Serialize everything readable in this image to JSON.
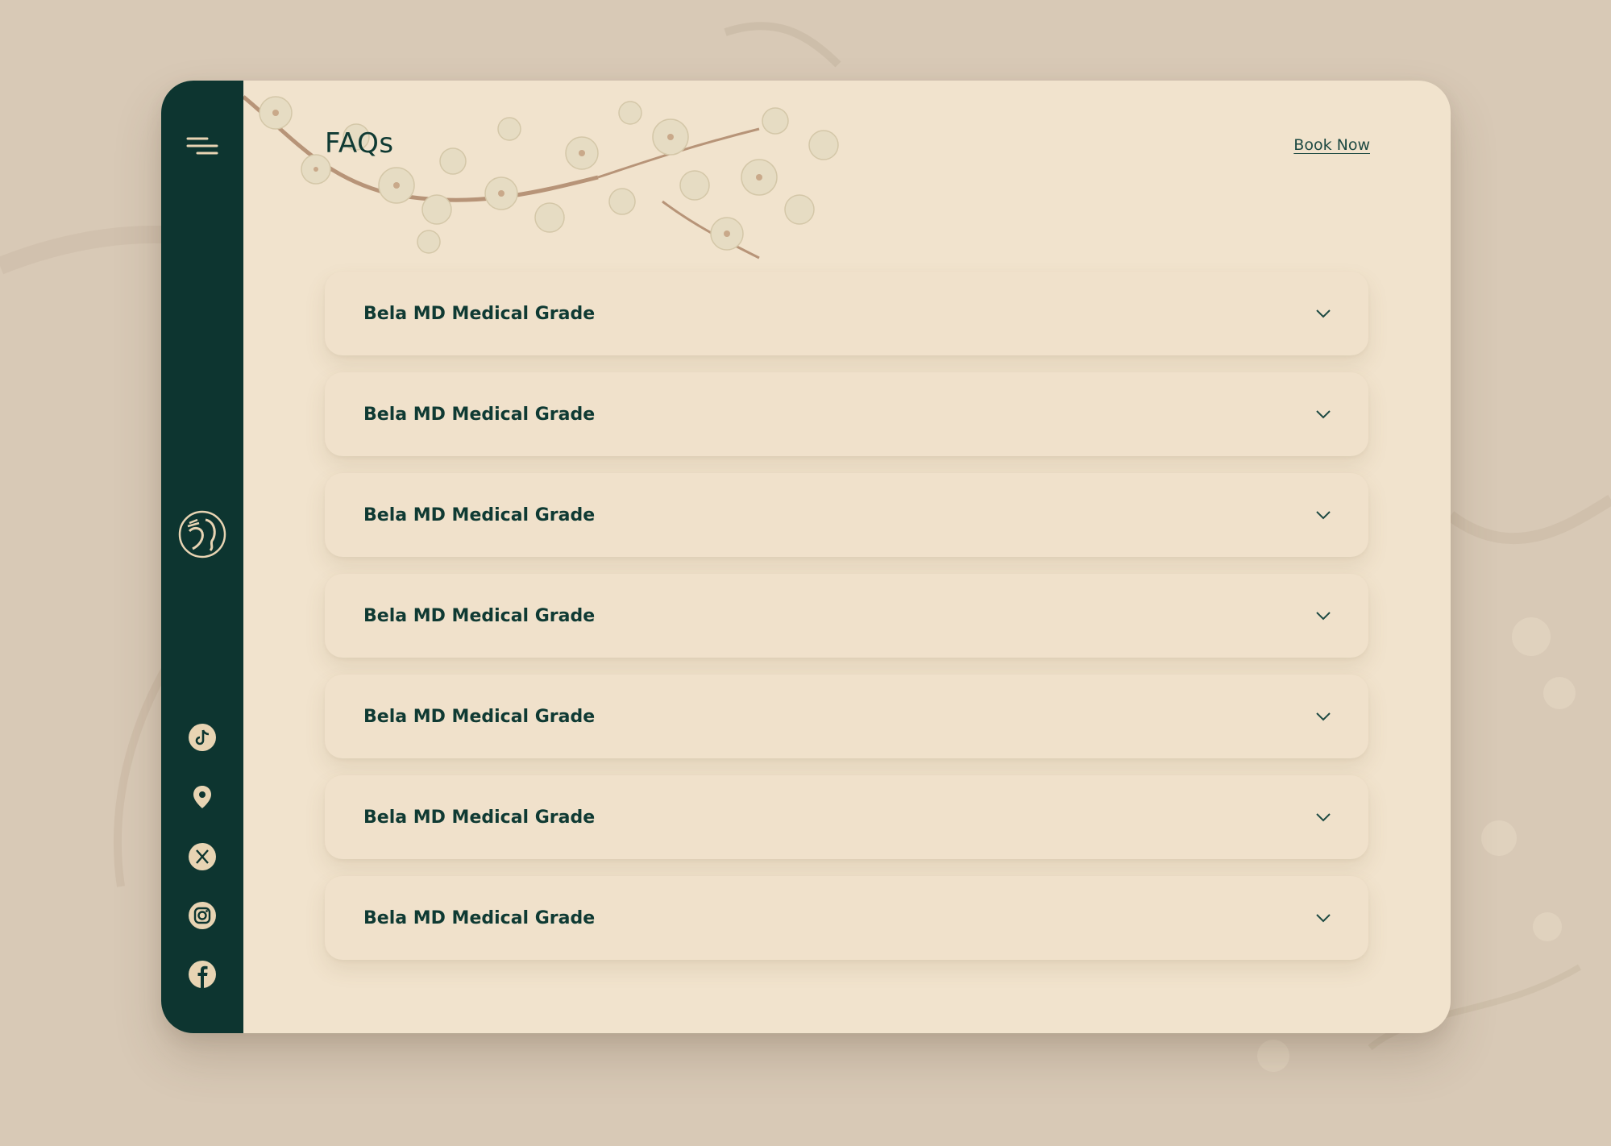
{
  "header": {
    "title": "FAQs",
    "book_now": "Book Now"
  },
  "faqs": [
    {
      "question": "Bela MD Medical Grade"
    },
    {
      "question": "Bela MD Medical Grade"
    },
    {
      "question": "Bela MD Medical Grade"
    },
    {
      "question": "Bela MD Medical Grade"
    },
    {
      "question": "Bela MD Medical Grade"
    },
    {
      "question": "Bela MD Medical Grade"
    },
    {
      "question": "Bela MD Medical Grade"
    }
  ],
  "sidebar": {
    "menu_icon": "menu-icon",
    "logo_icon": "woman-profile-logo",
    "socials": [
      "tiktok-icon",
      "location-pin-icon",
      "x-icon",
      "instagram-icon",
      "facebook-icon"
    ]
  },
  "colors": {
    "sidebar": "#0d3530",
    "card": "#f1e3cd",
    "background": "#d8c9b6",
    "text": "#0f3a33",
    "accent": "#e8d4b3"
  }
}
